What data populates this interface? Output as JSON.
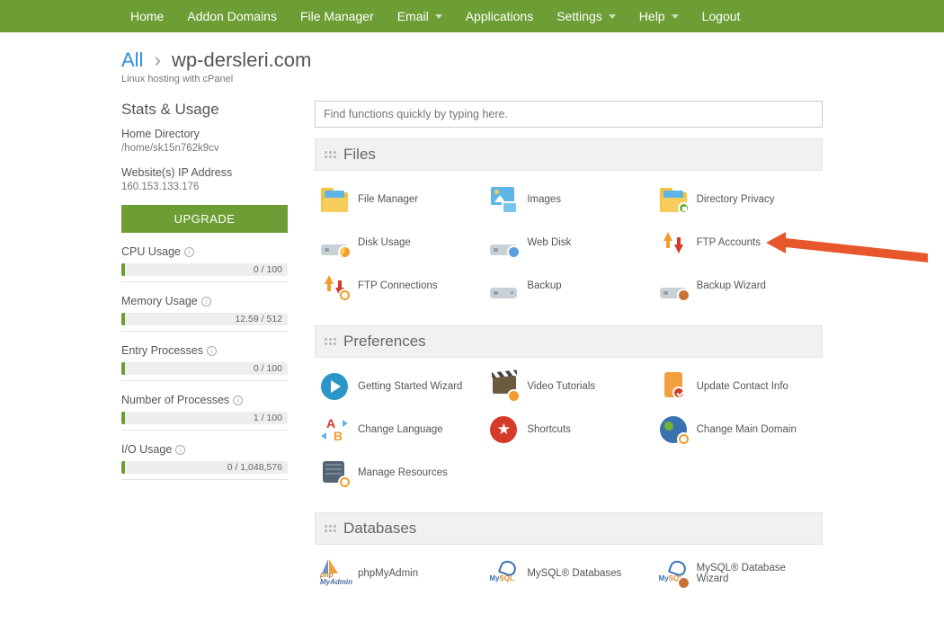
{
  "nav": {
    "home": "Home",
    "addon": "Addon Domains",
    "file": "File Manager",
    "email": "Email",
    "apps": "Applications",
    "settings": "Settings",
    "help": "Help",
    "logout": "Logout"
  },
  "breadcrumb": {
    "all": "All",
    "domain": "wp-dersleri.com"
  },
  "subtitle": "Linux hosting with cPanel",
  "sidebar": {
    "stats_title": "Stats & Usage",
    "home_dir_label": "Home Directory",
    "home_dir_value": "/home/sk15n762k9cv",
    "ip_label": "Website(s) IP Address",
    "ip_value": "160.153.133.176",
    "upgrade": "UPGRADE",
    "stats": [
      {
        "label": "CPU Usage",
        "value": "0 / 100"
      },
      {
        "label": "Memory Usage",
        "value": "12.59 / 512"
      },
      {
        "label": "Entry Processes",
        "value": "0 / 100"
      },
      {
        "label": "Number of Processes",
        "value": "1 / 100"
      },
      {
        "label": "I/O Usage",
        "value": "0 / 1,048,576"
      }
    ]
  },
  "search": {
    "placeholder": "Find functions quickly by typing here."
  },
  "sections": {
    "files": {
      "title": "Files",
      "items": [
        "File Manager",
        "Images",
        "Directory Privacy",
        "Disk Usage",
        "Web Disk",
        "FTP Accounts",
        "FTP Connections",
        "Backup",
        "Backup Wizard"
      ]
    },
    "prefs": {
      "title": "Preferences",
      "items": [
        "Getting Started Wizard",
        "Video Tutorials",
        "Update Contact Info",
        "Change Language",
        "Shortcuts",
        "Change Main Domain",
        "Manage Resources"
      ]
    },
    "db": {
      "title": "Databases",
      "items": [
        "phpMyAdmin",
        "MySQL® Databases",
        "MySQL® Database Wizard"
      ]
    }
  }
}
